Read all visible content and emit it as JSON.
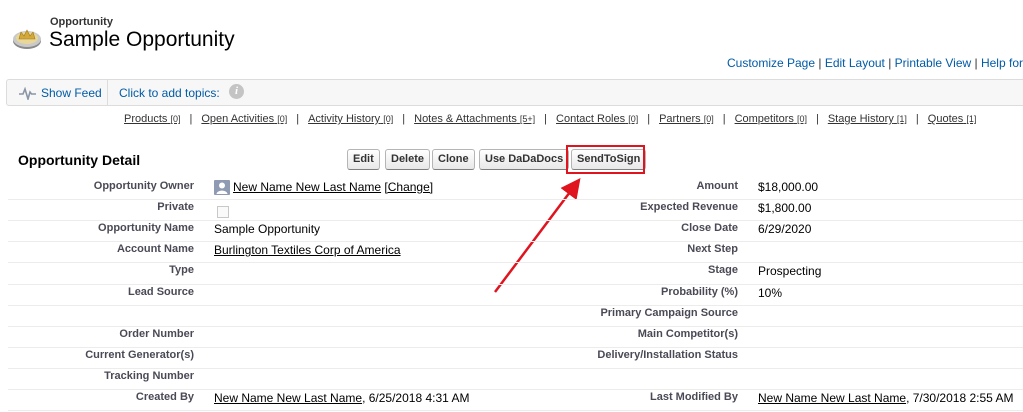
{
  "header": {
    "record_type": "Opportunity",
    "title": "Sample Opportunity"
  },
  "links": {
    "customize": "Customize Page",
    "edit_layout": "Edit Layout",
    "printable": "Printable View",
    "help": "Help for"
  },
  "feed": {
    "show_feed": "Show Feed",
    "topics": "Click to add topics:"
  },
  "related": [
    {
      "label": "Products",
      "count": "[0]"
    },
    {
      "label": "Open Activities",
      "count": "[0]"
    },
    {
      "label": "Activity History",
      "count": "[0]"
    },
    {
      "label": "Notes & Attachments",
      "count": "[5+]"
    },
    {
      "label": "Contact Roles",
      "count": "[0]"
    },
    {
      "label": "Partners",
      "count": "[0]"
    },
    {
      "label": "Competitors",
      "count": "[0]"
    },
    {
      "label": "Stage History",
      "count": "[1]"
    },
    {
      "label": "Quotes",
      "count": "[1]"
    }
  ],
  "detail": {
    "title": "Opportunity Detail",
    "buttons": {
      "edit": "Edit",
      "delete": "Delete",
      "clone": "Clone",
      "dadadocs": "Use DaDaDocs",
      "sendtosign": "SendToSign"
    },
    "left": [
      {
        "label": "Opportunity Owner",
        "value": "New Name New Last Name",
        "extra": "[Change]"
      },
      {
        "label": "Private",
        "value": ""
      },
      {
        "label": "Opportunity Name",
        "value": "Sample Opportunity"
      },
      {
        "label": "Account Name",
        "value": "Burlington Textiles Corp of America"
      },
      {
        "label": "Type",
        "value": ""
      },
      {
        "label": "Lead Source",
        "value": ""
      },
      {
        "label": "",
        "value": ""
      },
      {
        "label": "Order Number",
        "value": ""
      },
      {
        "label": "Current Generator(s)",
        "value": ""
      },
      {
        "label": "Tracking Number",
        "value": ""
      },
      {
        "label": "Created By",
        "value": "New Name New Last Name",
        "extra": ", 6/25/2018 4:31 AM"
      }
    ],
    "right": [
      {
        "label": "Amount",
        "value": "$18,000.00"
      },
      {
        "label": "Expected Revenue",
        "value": "$1,800.00"
      },
      {
        "label": "Close Date",
        "value": "6/29/2020"
      },
      {
        "label": "Next Step",
        "value": ""
      },
      {
        "label": "Stage",
        "value": "Prospecting"
      },
      {
        "label": "Probability (%)",
        "value": "10%"
      },
      {
        "label": "Primary Campaign Source",
        "value": ""
      },
      {
        "label": "Main Competitor(s)",
        "value": ""
      },
      {
        "label": "Delivery/Installation Status",
        "value": ""
      },
      {
        "label": "",
        "value": ""
      },
      {
        "label": "Last Modified By",
        "value": "New Name New Last Name",
        "extra": ", 7/30/2018 2:55 AM"
      }
    ]
  },
  "colors": {
    "highlight": "#e0141e",
    "link": "#015ba7"
  }
}
